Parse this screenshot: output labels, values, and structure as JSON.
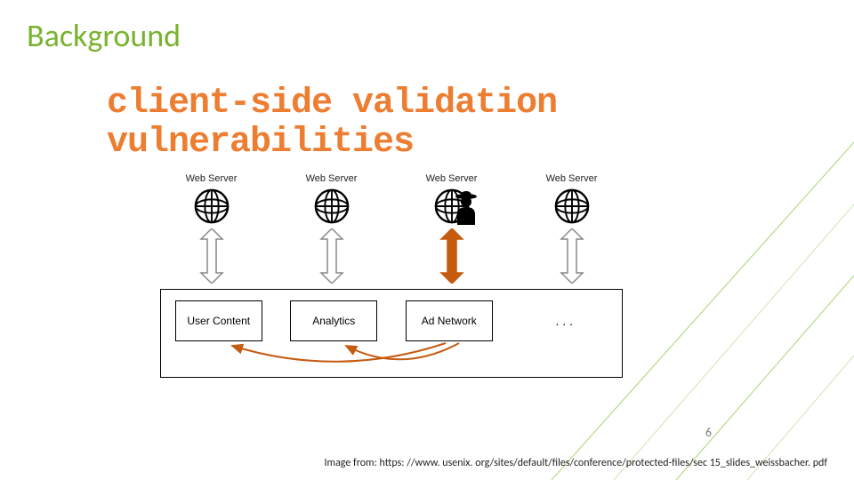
{
  "title": "Background",
  "subtitle_line1": "client-side validation",
  "subtitle_line2": "vulnerabilities",
  "servers": {
    "s1": "Web Server",
    "s2": "Web Server",
    "s3": "Web Server",
    "s4": "Web Server"
  },
  "modules": {
    "m1": "User Content",
    "m2": "Analytics",
    "m3": "Ad Network",
    "m4": ". . ."
  },
  "page_number": "6",
  "image_credit": "Image from: https: //www. usenix. org/sites/default/files/conference/protected-files/sec 15_slides_weissbacher. pdf",
  "colors": {
    "accent_green": "#79b22f",
    "accent_orange": "#ed7d31",
    "attack_arrow": "#c55a11"
  }
}
